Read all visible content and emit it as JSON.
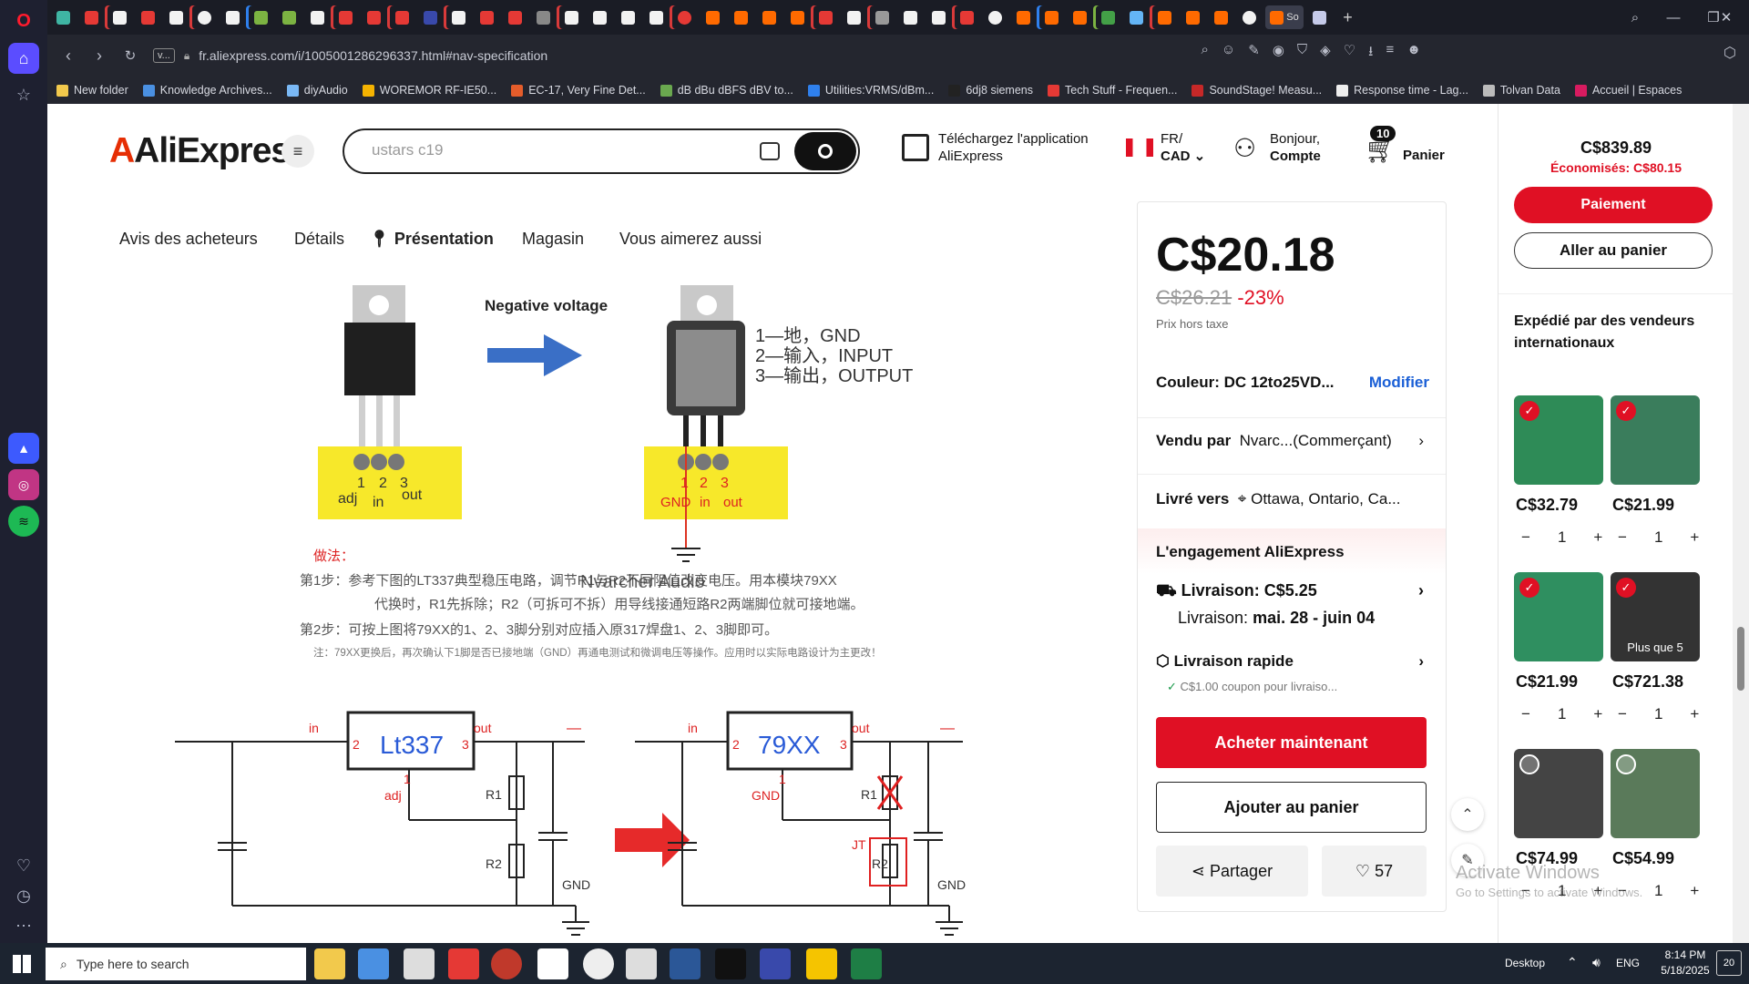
{
  "browser": {
    "url": "fr.aliexpress.com/i/1005001286296337.html#nav-specification",
    "site_info_label": "v...",
    "active_tab_title": "So",
    "bookmarks": [
      {
        "label": "New folder",
        "color": "#f2c94c"
      },
      {
        "label": "Knowledge Archives...",
        "color": "#4a90e2"
      },
      {
        "label": "diyAudio",
        "color": "#7ab8f5"
      },
      {
        "label": "WOREMOR RF-IE50...",
        "color": "#f5b301"
      },
      {
        "label": "EC-17, Very Fine Det...",
        "color": "#e55d2b"
      },
      {
        "label": "dB dBu dBFS dBV to...",
        "color": "#6aa84f"
      },
      {
        "label": "Utilities:VRMS/dBm...",
        "color": "#2f80ed"
      },
      {
        "label": "6dj8 siemens",
        "color": "#222222"
      },
      {
        "label": "Tech Stuff - Frequen...",
        "color": "#e53935"
      },
      {
        "label": "SoundStage! Measu...",
        "color": "#c62828"
      },
      {
        "label": "Response time - Lag...",
        "color": "#eeeeee"
      },
      {
        "label": "Tolvan Data",
        "color": "#bbbbbb"
      },
      {
        "label": "Accueil | Espaces",
        "color": "#d81b60"
      }
    ]
  },
  "header": {
    "logo": "AliExpress",
    "search_value": "ustars c19",
    "app_line1": "Téléchargez l'application",
    "app_line2": "AliExpress",
    "lang": "FR/",
    "currency": "CAD",
    "account_line1": "Bonjour,",
    "account_line2": "Compte",
    "cart_count": "10",
    "cart_label": "Panier"
  },
  "tabs": [
    "Avis des acheteurs",
    "Détails",
    "Présentation",
    "Magasin",
    "Vous aimerez aussi"
  ],
  "image": {
    "neg_voltage": "Negative voltage",
    "pin1": "1—地，GND",
    "pin2": "2—输入，INPUT",
    "pin3": "3—输出，OUTPUT",
    "left_pins": [
      "1",
      "2",
      "3"
    ],
    "left_pin_names": [
      "adj",
      "in",
      "out"
    ],
    "right_pins": [
      "1",
      "2",
      "3"
    ],
    "right_pin_names": [
      "GND",
      "in",
      "out"
    ],
    "overlay": "Nvarcher Audio",
    "method": "做法：",
    "step1": "第1步：参考下图的LT337典型稳压电路，调节R1与R2不同阻值改变电压。用本模块79XX",
    "step1b": "代换时，R1先拆除；R2（可拆可不拆）用导线接通短路R2两端脚位就可接地端。",
    "step2": "第2步：可按上图将79XX的1、2、3脚分别对应插入原317焊盘1、2、3脚即可。",
    "note": "注：79XX更换后，再次确认下1脚是否已接地端（GND）再通电测试和微调电压等操作。应用时以实际电路设计为主更改！",
    "lt337": "Lt337",
    "xx79": "79XX",
    "in": "in",
    "out": "out",
    "adj": "adj",
    "gnd": "GND",
    "r1": "R1",
    "r2": "R2",
    "jt": "JT",
    "minus": "—",
    "plus": "+",
    "pin_nums": [
      "2",
      "3",
      "1"
    ]
  },
  "buybox": {
    "price": "C$20.18",
    "old_price": "C$26.21",
    "discount": "-23%",
    "tax_note": "Prix hors taxe",
    "color_label": "Couleur: DC 12to25VD...",
    "modify": "Modifier",
    "sold_by_label": "Vendu par",
    "sold_by_value": "Nvarc...(Commerçant)",
    "ship_to_label": "Livré vers",
    "ship_to_value": "Ottawa, Ontario, Ca...",
    "commitment": "L'engagement AliExpress",
    "shipping_fee": "Livraison: C$5.25",
    "delivery_label": "Livraison:",
    "delivery_dates": "mai. 28 - juin 04",
    "fast": "Livraison rapide",
    "coupon": "C$1.00 coupon pour livraiso...",
    "buy_now": "Acheter maintenant",
    "add_cart": "Ajouter au panier",
    "share": "Partager",
    "likes": "57"
  },
  "cart_sidebar": {
    "total": "C$839.89",
    "savings": "Économisés: C$80.15",
    "pay": "Paiement",
    "go_cart": "Aller au panier",
    "shipped_by": "Expédié par des vendeurs internationaux",
    "items": [
      {
        "price": "C$32.79",
        "qty": "1",
        "checked": true,
        "color": "#2e8b57"
      },
      {
        "price": "C$21.99",
        "qty": "1",
        "checked": true,
        "color": "#3a7d5c"
      },
      {
        "price": "C$21.99",
        "qty": "1",
        "checked": true,
        "color": "#2f8f60"
      },
      {
        "price": "C$721.38",
        "qty": "1",
        "checked": true,
        "color": "#333333",
        "more": "Plus que 5"
      },
      {
        "price": "C$74.99",
        "qty": "1",
        "checked": false,
        "color": "#444444"
      },
      {
        "price": "C$54.99",
        "qty": "1",
        "checked": false,
        "color": "#5a7a5a"
      }
    ],
    "minus": "−",
    "plus": "+"
  },
  "watermark": {
    "line1": "Activate Windows",
    "line2": "Go to Settings to activate Windows."
  },
  "taskbar": {
    "search_placeholder": "Type here to search",
    "desktop": "Desktop",
    "lang": "ENG",
    "time": "8:14 PM",
    "date": "5/18/2025",
    "notif": "20"
  }
}
